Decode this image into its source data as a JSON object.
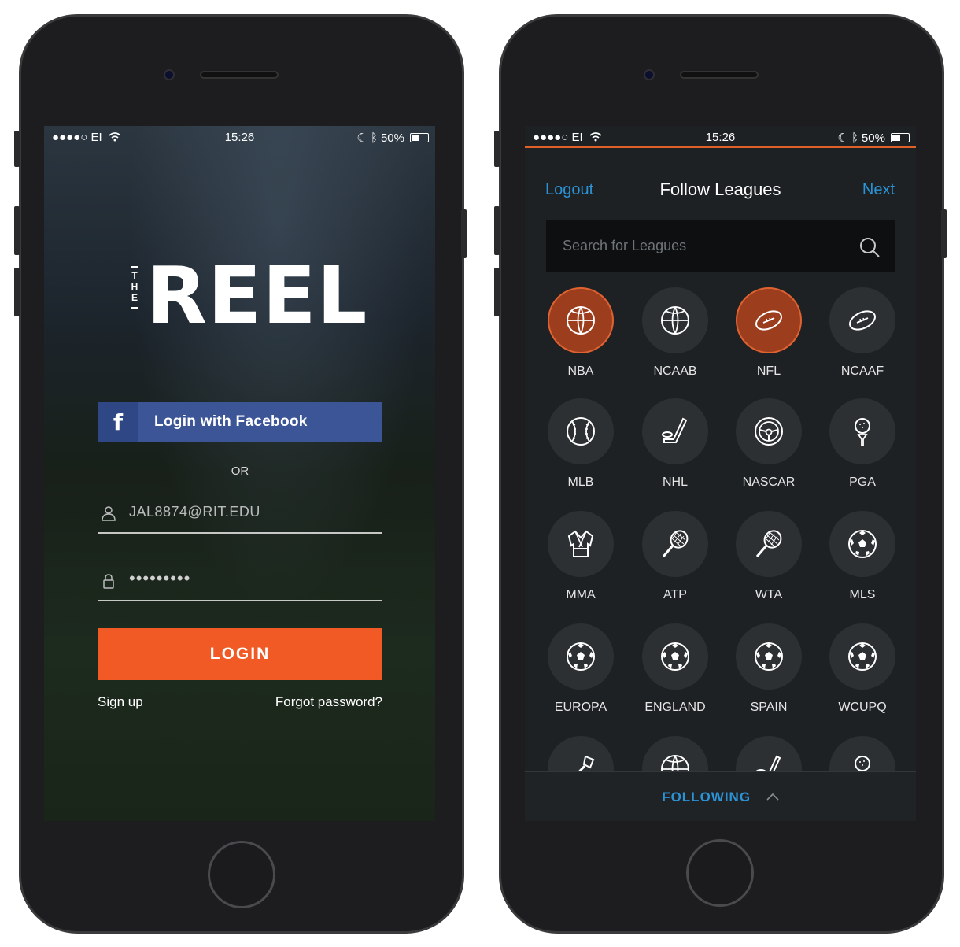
{
  "status_bar": {
    "carrier": "●●●●○ EI",
    "time": "15:26",
    "battery": "50%"
  },
  "login_screen": {
    "logo_small": [
      "T",
      "H",
      "E"
    ],
    "logo_main": "REEL",
    "facebook_button": "Login with Facebook",
    "facebook_icon": "f",
    "or_divider": "OR",
    "email_value": "JAL8874@RIT.EDU",
    "password_value": "•••••••••",
    "login_button": "LOGIN",
    "sign_up": "Sign up",
    "forgot_password": "Forgot password?"
  },
  "leagues_screen": {
    "nav_left": "Logout",
    "title": "Follow Leagues",
    "nav_right": "Next",
    "search_placeholder": "Search for Leagues",
    "footer": "FOLLOWING",
    "accent_color": "#2b93d6",
    "selected_color": "#e06231",
    "leagues": [
      {
        "label": "NBA",
        "icon": "basketball-icon",
        "selected": true
      },
      {
        "label": "NCAAB",
        "icon": "basketball-icon",
        "selected": false
      },
      {
        "label": "NFL",
        "icon": "football-icon",
        "selected": true
      },
      {
        "label": "NCAAF",
        "icon": "football-icon",
        "selected": false
      },
      {
        "label": "MLB",
        "icon": "baseball-icon",
        "selected": false
      },
      {
        "label": "NHL",
        "icon": "hockey-stick-icon",
        "selected": false
      },
      {
        "label": "NASCAR",
        "icon": "steering-wheel-icon",
        "selected": false
      },
      {
        "label": "PGA",
        "icon": "golf-ball-icon",
        "selected": false
      },
      {
        "label": "MMA",
        "icon": "gi-robe-icon",
        "selected": false
      },
      {
        "label": "ATP",
        "icon": "tennis-racket-icon",
        "selected": false
      },
      {
        "label": "WTA",
        "icon": "tennis-racket-icon",
        "selected": false
      },
      {
        "label": "MLS",
        "icon": "soccer-ball-icon",
        "selected": false
      },
      {
        "label": "EUROPA",
        "icon": "soccer-ball-icon",
        "selected": false
      },
      {
        "label": "ENGLAND",
        "icon": "soccer-ball-icon",
        "selected": false
      },
      {
        "label": "SPAIN",
        "icon": "soccer-ball-icon",
        "selected": false
      },
      {
        "label": "WCUPQ",
        "icon": "soccer-ball-icon",
        "selected": false
      }
    ],
    "partial_row": [
      {
        "icon": "lacrosse-stick-icon"
      },
      {
        "icon": "basketball-icon"
      },
      {
        "icon": "hockey-stick-icon"
      },
      {
        "icon": "golf-ball-icon"
      }
    ]
  }
}
